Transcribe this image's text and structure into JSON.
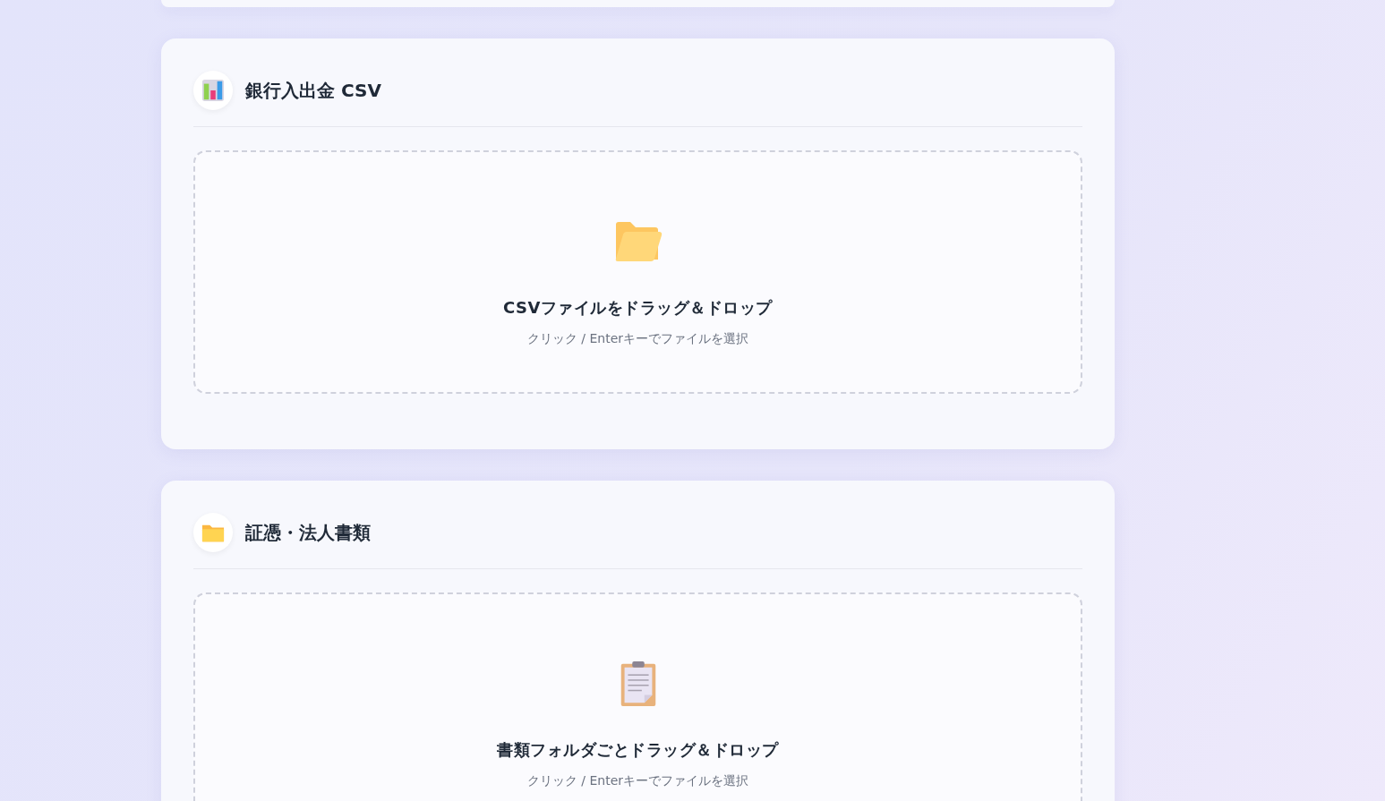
{
  "sections": [
    {
      "title": "銀行入出金 CSV",
      "dropzone": {
        "heading": "CSVファイルをドラッグ＆ドロップ",
        "hint": "クリック / Enterキーでファイルを選択"
      }
    },
    {
      "title": "証憑・法人書類",
      "dropzone": {
        "heading": "書類フォルダごとドラッグ＆ドロップ",
        "hint": "クリック / Enterキーでファイルを選択"
      }
    }
  ]
}
